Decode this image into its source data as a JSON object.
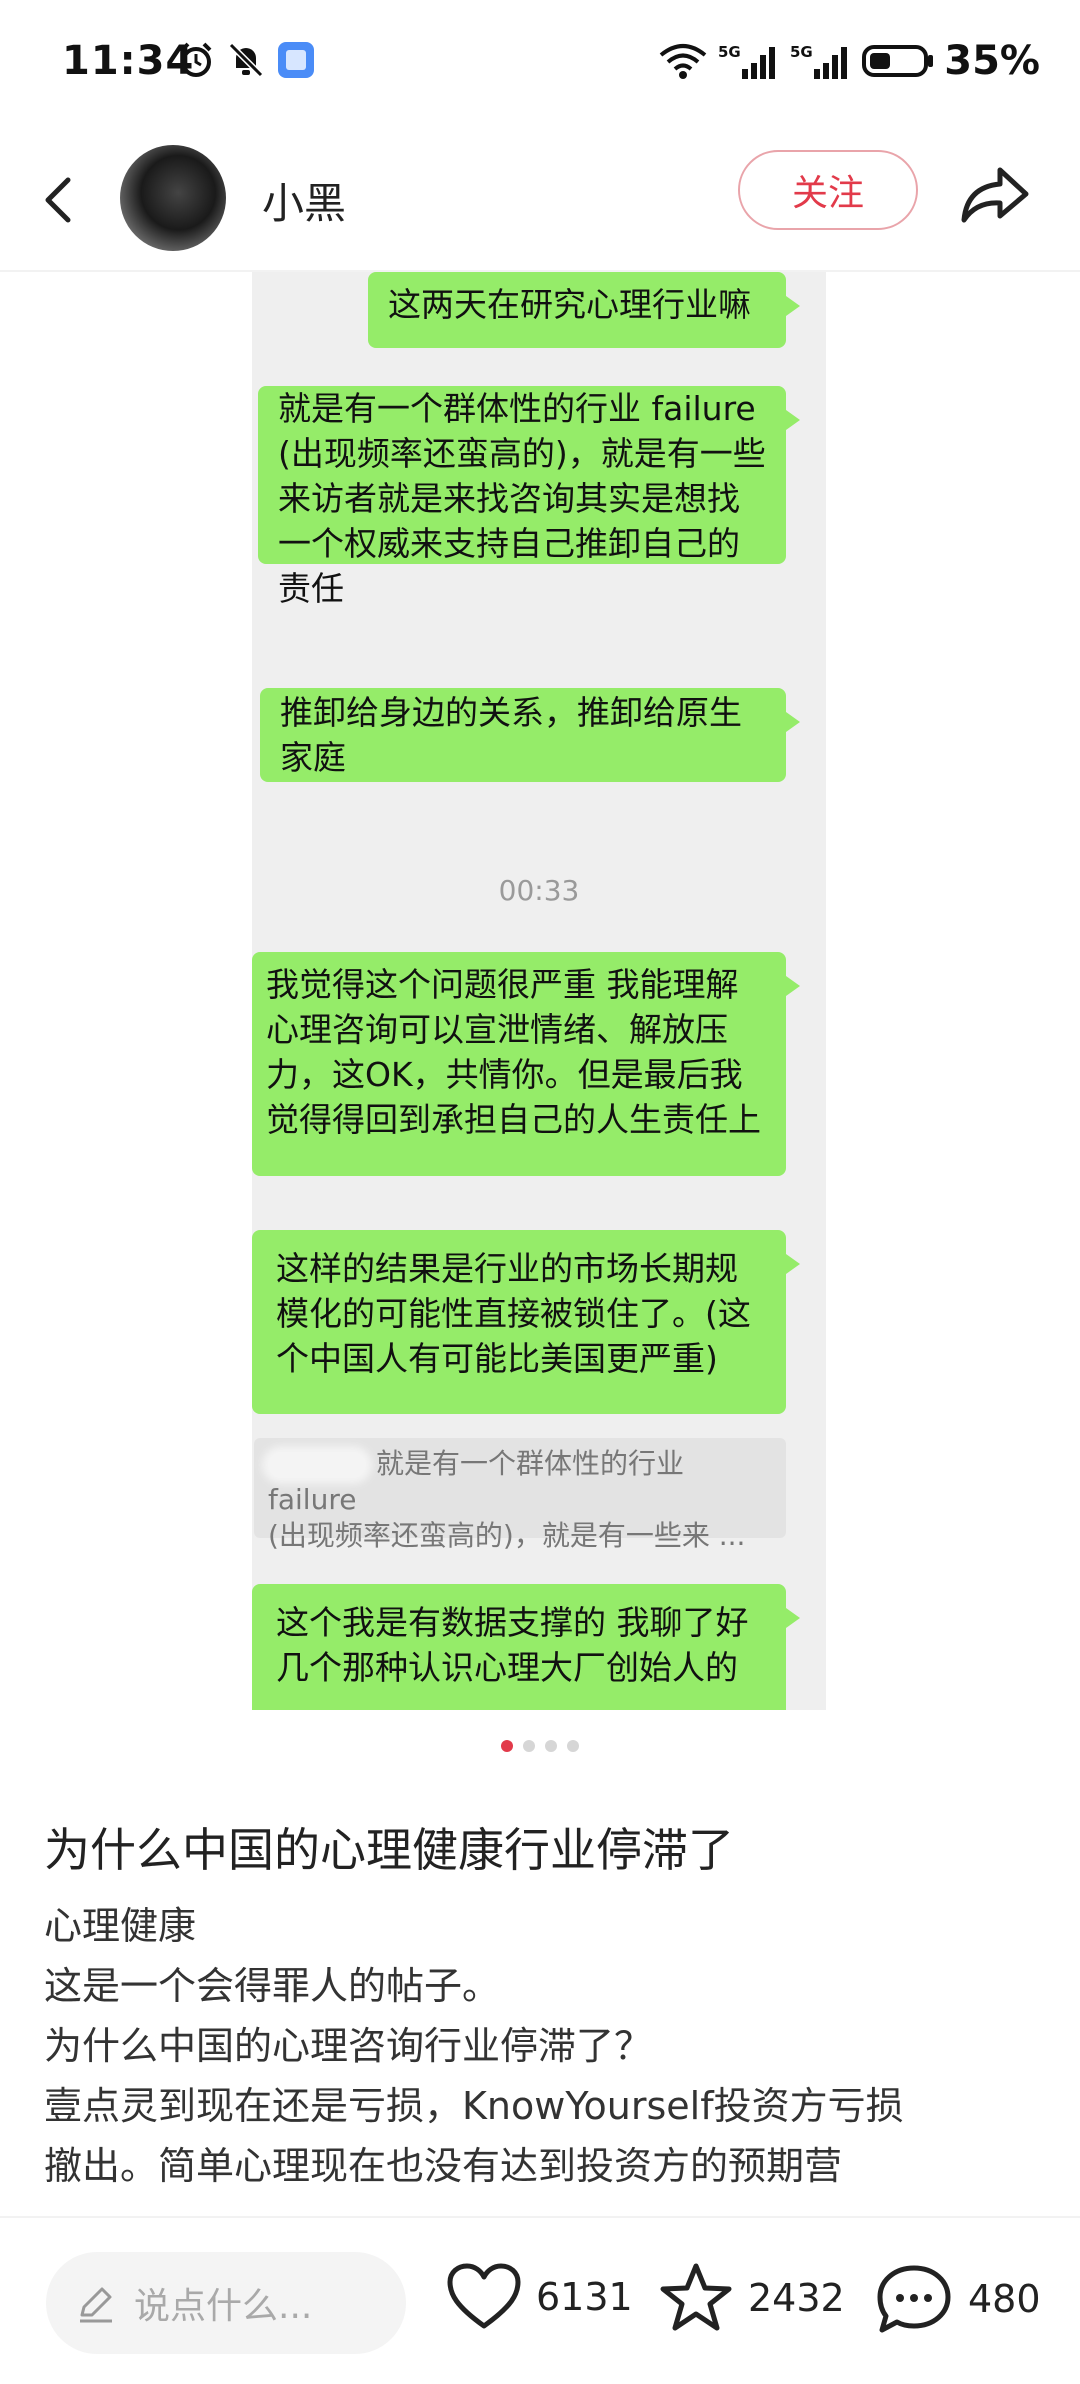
{
  "status_bar": {
    "time": "11:34",
    "battery": "35%",
    "signal1": "5G",
    "signal2": "5G"
  },
  "header": {
    "username": "小黑",
    "follow_label": "关注"
  },
  "chat": {
    "messages": [
      "这两天在研究心理行业嘛",
      "就是有一个群体性的行业 failure (出现频率还蛮高的)，就是有一些来访者就是来找咨询其实是想找一个权威来支持自己推卸自己的责任",
      "推卸给身边的关系，推卸给原生家庭",
      "我觉得这个问题很严重 我能理解心理咨询可以宣泄情绪、解放压力，这OK，共情你。但是最后我觉得得回到承担自己的人生责任上",
      "这样的结果是行业的市场长期规模化的可能性直接被锁住了。(这个中国人有可能比美国更严重)",
      "这个我是有数据支撑的 我聊了好几个那种认识心理大厂创始人的"
    ],
    "time_label": "00:33",
    "quote_line1": "就是有一个群体性的行业 failure",
    "quote_line2": "(出现频率还蛮高的)，就是有一些来 ..."
  },
  "post": {
    "title": "为什么中国的心理健康行业停滞了",
    "lines": [
      "心理健康",
      "这是一个会得罪人的帖子。",
      "为什么中国的心理咨询行业停滞了？",
      "壹点灵到现在还是亏损，KnowYourself投资方亏损",
      "撤出。简单心理现在也没有达到投资方的预期营"
    ]
  },
  "carousel": {
    "count": 4,
    "active_index": 0
  },
  "bottom_bar": {
    "comment_placeholder": "说点什么...",
    "likes": "6131",
    "stars": "2432",
    "comments": "480"
  },
  "colors": {
    "accent": "#e23a4a",
    "bubble": "#95ec69",
    "chat_bg": "#efefef"
  }
}
